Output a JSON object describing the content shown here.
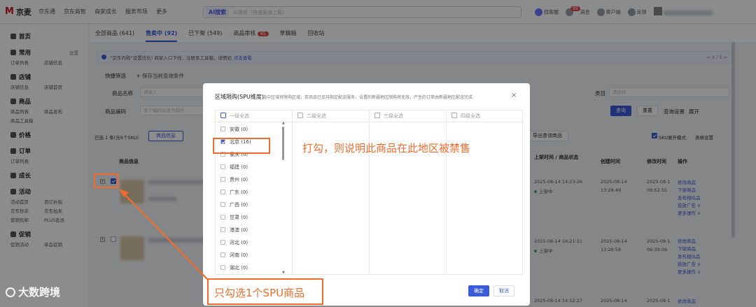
{
  "header": {
    "logo_text": "京麦",
    "nav": [
      "京东通",
      "京东商智",
      "商家成长",
      "服务市场",
      "更多"
    ],
    "search": {
      "ai_label": "AI搜索",
      "placeholder": "AI搜索（快速渠道上报）"
    },
    "right": [
      {
        "label": "找客服",
        "icon": "service-icon"
      },
      {
        "label": "消息",
        "icon": "message-icon",
        "badge": "99"
      },
      {
        "label": "客户端",
        "icon": "client-icon"
      },
      {
        "label": "反馈",
        "icon": "feedback-icon"
      }
    ]
  },
  "sidebar": [
    {
      "title": "首页",
      "icon": "home-icon",
      "subs": []
    },
    {
      "title": "常用",
      "icon": "star-icon",
      "extra": "设置",
      "subs": [
        "订单列表",
        "店铺信息"
      ]
    },
    {
      "title": "店铺",
      "icon": "shop-icon",
      "extra": "",
      "subs": [
        "店铺信息",
        "店铺首页"
      ]
    },
    {
      "title": "商品",
      "icon": "goods-icon",
      "extra": "",
      "subs": [
        "商品列表",
        "商品发布",
        "商品工具箱"
      ]
    },
    {
      "title": "价格",
      "icon": "price-icon",
      "extra": "",
      "subs": []
    },
    {
      "title": "订单",
      "icon": "order-icon",
      "extra": "",
      "subs": [
        "订单列表"
      ]
    },
    {
      "title": "成长",
      "icon": "growth-icon",
      "extra": "",
      "subs": []
    },
    {
      "title": "活动",
      "icon": "activity-icon",
      "extra": "",
      "subs": [
        "活动首页",
        "百亿补贴",
        "京东秒杀",
        "京东拍卖",
        "营销包邮",
        "PLUS会员"
      ]
    },
    {
      "title": "促销",
      "icon": "promo-icon",
      "extra": "",
      "subs": [
        "促销活动",
        "单品促销"
      ]
    }
  ],
  "tabs": [
    {
      "label": "全部商品 (641)"
    },
    {
      "label": "售卖中 (92)",
      "active": true
    },
    {
      "label": "已下架 (549)"
    },
    {
      "label": "商品审核",
      "count": "85"
    },
    {
      "label": "草稿箱"
    },
    {
      "label": "回收站"
    }
  ],
  "notice": {
    "text": "“京东内购”设置优化! 商家入口下线，注册至工具箱，详情如",
    "link": "点击查看",
    "page": "< 4 / 5 >"
  },
  "filters": {
    "quick": "快捷筛选",
    "save": "+ 保存当前查询条件",
    "name_label": "商品名称",
    "name_placeholder": "请输入",
    "code_label": "商品编码",
    "code_placeholder": "多个编码以逗号隔开",
    "category_label": "类目",
    "category_placeholder": "请选择",
    "query": "查询",
    "reset": "重置",
    "query_settings": "查询设置",
    "expand": "展开"
  },
  "table": {
    "selected": "已选 1 条(含6个SKU)",
    "batch_btn": "商品信息",
    "export": "导出查询商品",
    "sku_mode": "SKU展开模式",
    "table_settings": "表格设置",
    "headers": {
      "info": "商品信息",
      "time": "上架时间 / 商品状态",
      "created": "创建时间",
      "modified": "修改时间",
      "ops": "操作"
    },
    "rows": [
      {
        "up_time": "2025-08-14 14:23:26",
        "status": "上架中",
        "created_date": "2025-08-14",
        "created_time": "13:28:49",
        "mod_date": "2025-08-1",
        "mod_time": "08:52:55",
        "ops": [
          "修改商品",
          "下架商品",
          "发布相似品",
          "投放广告 ∨",
          "更多操作 ∨"
        ]
      },
      {
        "up_time": "2025-08-14 14:21:21",
        "status": "上架中",
        "created_date": "2025-08-14",
        "created_time": "13:26:58",
        "mod_date": "2025-08-1",
        "mod_time": "06:39:09",
        "ops": [
          "修改商品",
          "下架商品",
          "发布相似品",
          "投放广告 ∨",
          "更多操作 ∨"
        ]
      },
      {
        "up_time": "2025-08-14 14:12:27",
        "status": "",
        "created_date": "2025-08-14",
        "created_time": "",
        "mod_date": "2025-08-1",
        "mod_time": "",
        "ops": [
          "修改商品"
        ]
      }
    ]
  },
  "modal": {
    "title": "区域限购(SPU维度)",
    "hint": "选中区域将限购区域，若商品已支持指定配送服务，设置的新疆地区限购将无效，产生的订单由新疆地区配送完成",
    "columns": [
      "一级全选",
      "二级全选",
      "三级全选",
      "四级全选"
    ],
    "provinces": [
      {
        "name": "安徽 (0)",
        "checked": false
      },
      {
        "name": "北京 (16)",
        "checked": true
      },
      {
        "name": "重庆 (0)",
        "checked": false
      },
      {
        "name": "福建 (0)",
        "checked": false
      },
      {
        "name": "贵州 (0)",
        "checked": false
      },
      {
        "name": "广东 (0)",
        "checked": false
      },
      {
        "name": "广西 (0)",
        "checked": false
      },
      {
        "name": "甘肃 (0)",
        "checked": false
      },
      {
        "name": "港澳 (0)",
        "checked": false
      },
      {
        "name": "河北 (0)",
        "checked": false
      },
      {
        "name": "河南 (0)",
        "checked": false
      },
      {
        "name": "湖北 (0)",
        "checked": false
      }
    ],
    "ok": "确定",
    "cancel": "取消"
  },
  "annotations": {
    "checked_note": "打勾，则说明此商品在此地区被禁售",
    "select_note": "只勾选1个SPU商品",
    "color": "#f26b2c"
  },
  "watermark": "大数跨境"
}
